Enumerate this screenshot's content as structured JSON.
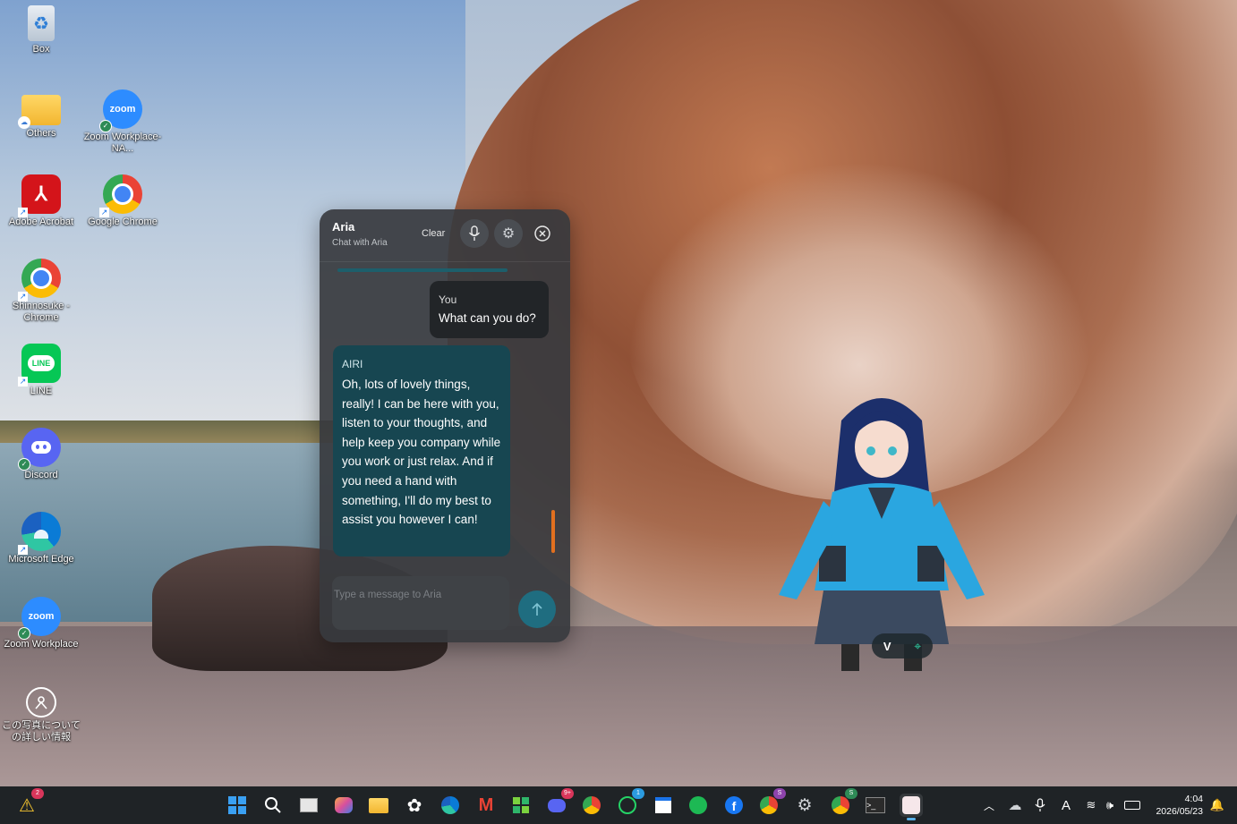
{
  "desktop": {
    "icons": [
      {
        "label": "Box",
        "icon": "recycle-bin-icon"
      },
      {
        "label": "Others",
        "icon": "folder-icon"
      },
      {
        "label": "Zoom Workplace-NA...",
        "icon": "zoom-icon"
      },
      {
        "label": "Adobe Acrobat",
        "icon": "acrobat-icon"
      },
      {
        "label": "Google Chrome",
        "icon": "chrome-icon"
      },
      {
        "label": "Shinnosuke - Chrome",
        "icon": "chrome-profile-icon"
      },
      {
        "label": "LINE",
        "icon": "line-icon"
      },
      {
        "label": "Discord",
        "icon": "discord-icon"
      },
      {
        "label": "Microsoft Edge",
        "icon": "edge-icon"
      },
      {
        "label": "Zoom Workplace",
        "icon": "zoom-icon"
      },
      {
        "label": "この写真についての詳しい情報",
        "icon": "info-icon"
      }
    ],
    "zoom_text": "zoom",
    "line_text": "LINE"
  },
  "chat": {
    "title": "Aria",
    "subtitle": "Chat with Aria",
    "clear_label": "Clear",
    "messages": [
      {
        "sender": "You",
        "text": "What can you do?"
      },
      {
        "sender": "AIRI",
        "text": "Oh, lots of lovely things, really! I can be here with you, listen to your thoughts, and help keep you company while you work or just relax. And if you need a hand with something, I'll do my best to assist you however I can!"
      }
    ],
    "input_placeholder": "Type a message to Aria",
    "accent_color": "#1f6d80"
  },
  "character_controls": {
    "expand_label": "V"
  },
  "taskbar": {
    "weather_badge": "2",
    "discord_badge": "9+",
    "whatsapp_badge": "1",
    "chrome_badge": "S",
    "time": "4:04",
    "date": "2026/05/23",
    "ime_label": "A"
  }
}
